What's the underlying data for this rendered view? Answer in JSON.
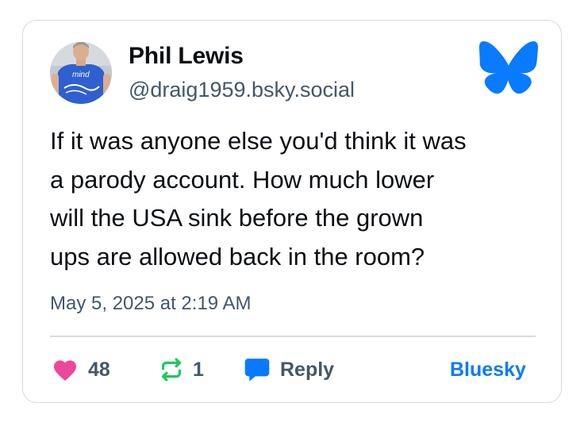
{
  "author": {
    "display_name": "Phil Lewis",
    "handle": "@draig1959.bsky.social",
    "avatar_shirt_text": "mind"
  },
  "post": {
    "text": "If it was anyone else you'd think it was\na parody account. How much lower\nwill the USA sink before the grown\nups are allowed back in the room?",
    "timestamp": "May 5, 2025 at 2:19 AM"
  },
  "actions": {
    "likes": "48",
    "reposts": "1",
    "reply_label": "Reply",
    "open_label": "Bluesky"
  },
  "icons": {
    "like": "heart-icon",
    "repost": "repost-icon",
    "reply": "speech-bubble-icon",
    "brand": "bluesky-butterfly-icon"
  },
  "colors": {
    "brand_blue": "#0a7aff",
    "like_pink": "#ec4899",
    "repost_green": "#22c55e",
    "secondary_text": "#42576c",
    "border": "#d4dbe2"
  }
}
